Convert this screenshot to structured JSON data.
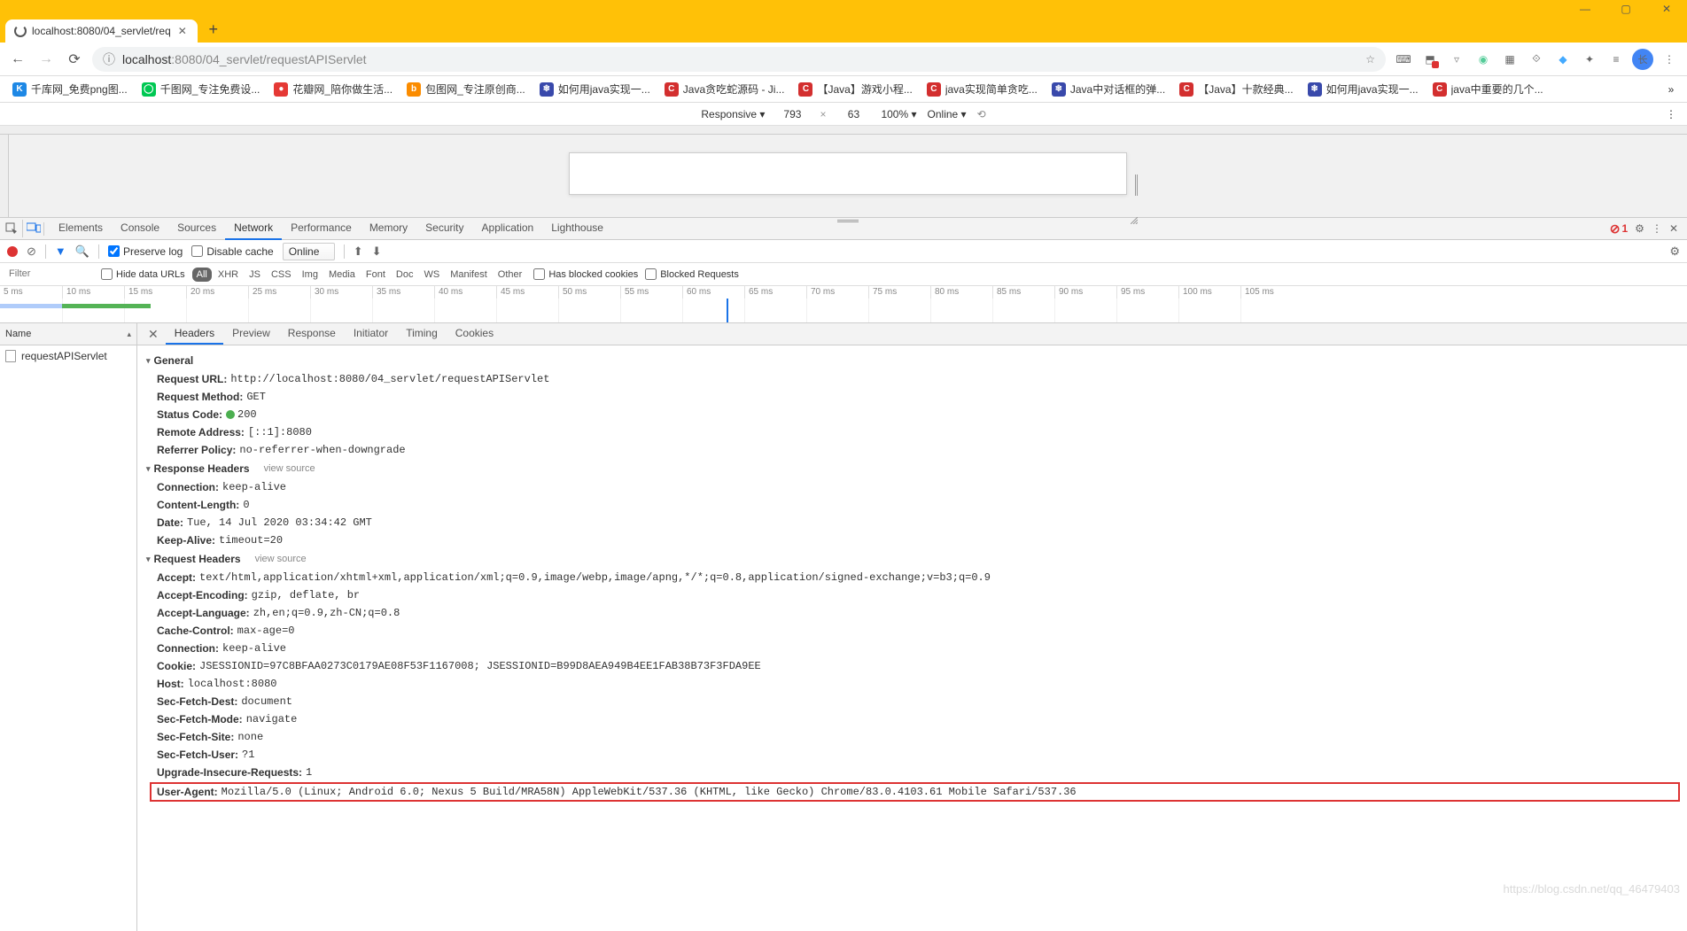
{
  "window": {
    "title": "localhost:8080/04_servlet/req"
  },
  "addressbar": {
    "url_host": "localhost",
    "url_port": ":8080",
    "url_path": "/04_servlet/requestAPIServlet"
  },
  "bookmarks": [
    {
      "label": "千库网_免费png图...",
      "color": "#1e88e5",
      "ic": "K"
    },
    {
      "label": "千图网_专注免费设...",
      "color": "#00c853",
      "ic": "◯"
    },
    {
      "label": "花瓣网_陪你做生活...",
      "color": "#e53935",
      "ic": "●"
    },
    {
      "label": "包图网_专注原创商...",
      "color": "#fb8c00",
      "ic": "b"
    },
    {
      "label": "如何用java实现一...",
      "color": "#3949ab",
      "ic": "❄"
    },
    {
      "label": "Java贪吃蛇源码 - Ji...",
      "color": "#d32f2f",
      "ic": "C"
    },
    {
      "label": "【Java】游戏小程...",
      "color": "#d32f2f",
      "ic": "C"
    },
    {
      "label": "java实现简单贪吃...",
      "color": "#d32f2f",
      "ic": "C"
    },
    {
      "label": "Java中对话框的弹...",
      "color": "#3949ab",
      "ic": "❄"
    },
    {
      "label": "【Java】十款经典...",
      "color": "#d32f2f",
      "ic": "C"
    },
    {
      "label": "如何用java实现一...",
      "color": "#3949ab",
      "ic": "❄"
    },
    {
      "label": "java中重要的几个...",
      "color": "#d32f2f",
      "ic": "C"
    }
  ],
  "device_toolbar": {
    "device": "Responsive",
    "w": "793",
    "h": "63",
    "zoom": "100%",
    "throttle": "Online"
  },
  "devtools": {
    "tabs": [
      "Elements",
      "Console",
      "Sources",
      "Network",
      "Performance",
      "Memory",
      "Security",
      "Application",
      "Lighthouse"
    ],
    "active_tab": "Network",
    "errors": "1"
  },
  "network_toolbar": {
    "preserve": "Preserve log",
    "disable": "Disable cache",
    "throttle": "Online"
  },
  "filters": {
    "placeholder": "Filter",
    "hide": "Hide data URLs",
    "types": [
      "All",
      "XHR",
      "JS",
      "CSS",
      "Img",
      "Media",
      "Font",
      "Doc",
      "WS",
      "Manifest",
      "Other"
    ],
    "blocked_cookies": "Has blocked cookies",
    "blocked_req": "Blocked Requests"
  },
  "overview_ticks": [
    "5 ms",
    "10 ms",
    "15 ms",
    "20 ms",
    "25 ms",
    "30 ms",
    "35 ms",
    "40 ms",
    "45 ms",
    "50 ms",
    "55 ms",
    "60 ms",
    "65 ms",
    "70 ms",
    "75 ms",
    "80 ms",
    "85 ms",
    "90 ms",
    "95 ms",
    "100 ms",
    "105 ms"
  ],
  "reqlist": {
    "header": "Name",
    "items": [
      "requestAPIServlet"
    ]
  },
  "detail_tabs": [
    "Headers",
    "Preview",
    "Response",
    "Initiator",
    "Timing",
    "Cookies"
  ],
  "headers": {
    "general_title": "General",
    "general": [
      {
        "k": "Request URL:",
        "v": "http://localhost:8080/04_servlet/requestAPIServlet"
      },
      {
        "k": "Request Method:",
        "v": "GET"
      },
      {
        "k": "Status Code:",
        "v": "200",
        "status": true
      },
      {
        "k": "Remote Address:",
        "v": "[::1]:8080"
      },
      {
        "k": "Referrer Policy:",
        "v": "no-referrer-when-downgrade"
      }
    ],
    "response_title": "Response Headers",
    "view_source": "view source",
    "response": [
      {
        "k": "Connection:",
        "v": "keep-alive"
      },
      {
        "k": "Content-Length:",
        "v": "0"
      },
      {
        "k": "Date:",
        "v": "Tue, 14 Jul 2020 03:34:42 GMT"
      },
      {
        "k": "Keep-Alive:",
        "v": "timeout=20"
      }
    ],
    "request_title": "Request Headers",
    "request": [
      {
        "k": "Accept:",
        "v": "text/html,application/xhtml+xml,application/xml;q=0.9,image/webp,image/apng,*/*;q=0.8,application/signed-exchange;v=b3;q=0.9"
      },
      {
        "k": "Accept-Encoding:",
        "v": "gzip, deflate, br"
      },
      {
        "k": "Accept-Language:",
        "v": "zh,en;q=0.9,zh-CN;q=0.8"
      },
      {
        "k": "Cache-Control:",
        "v": "max-age=0"
      },
      {
        "k": "Connection:",
        "v": "keep-alive"
      },
      {
        "k": "Cookie:",
        "v": "JSESSIONID=97C8BFAA0273C0179AE08F53F1167008; JSESSIONID=B99D8AEA949B4EE1FAB38B73F3FDA9EE"
      },
      {
        "k": "Host:",
        "v": "localhost:8080"
      },
      {
        "k": "Sec-Fetch-Dest:",
        "v": "document"
      },
      {
        "k": "Sec-Fetch-Mode:",
        "v": "navigate"
      },
      {
        "k": "Sec-Fetch-Site:",
        "v": "none"
      },
      {
        "k": "Sec-Fetch-User:",
        "v": "?1"
      },
      {
        "k": "Upgrade-Insecure-Requests:",
        "v": "1"
      },
      {
        "k": "User-Agent:",
        "v": "Mozilla/5.0 (Linux; Android 6.0; Nexus 5 Build/MRA58N) AppleWebKit/537.36 (KHTML, like Gecko) Chrome/83.0.4103.61 Mobile Safari/537.36",
        "hl": true
      }
    ]
  },
  "watermark": "https://blog.csdn.net/qq_46479403"
}
